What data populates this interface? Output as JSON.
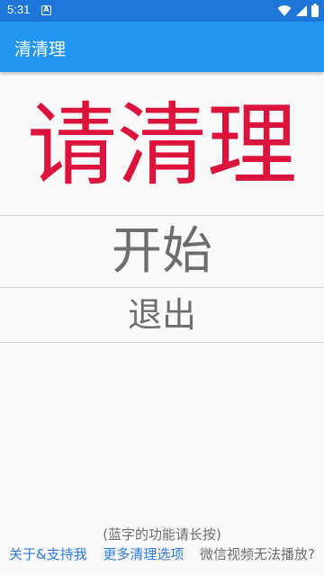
{
  "status_bar": {
    "time": "5:31",
    "notification_icon": "a-letter-icon",
    "icons": [
      "wifi-icon",
      "signal-icon",
      "battery-icon"
    ]
  },
  "app_bar": {
    "title": "清清理"
  },
  "main": {
    "big_title": "请清理",
    "start_label": "开始",
    "exit_label": "退出"
  },
  "footer": {
    "hint": "(蓝字的功能请长按)",
    "about_label": "关于&支持我",
    "more_label": "更多清理选项",
    "video_label": "微信视频无法播放?"
  },
  "colors": {
    "app_bar": "#2196f3",
    "status_bar": "#1e76d9",
    "title_red": "#dc143c",
    "link_blue": "#2c7be5",
    "gray_text": "#6d6d6d"
  }
}
